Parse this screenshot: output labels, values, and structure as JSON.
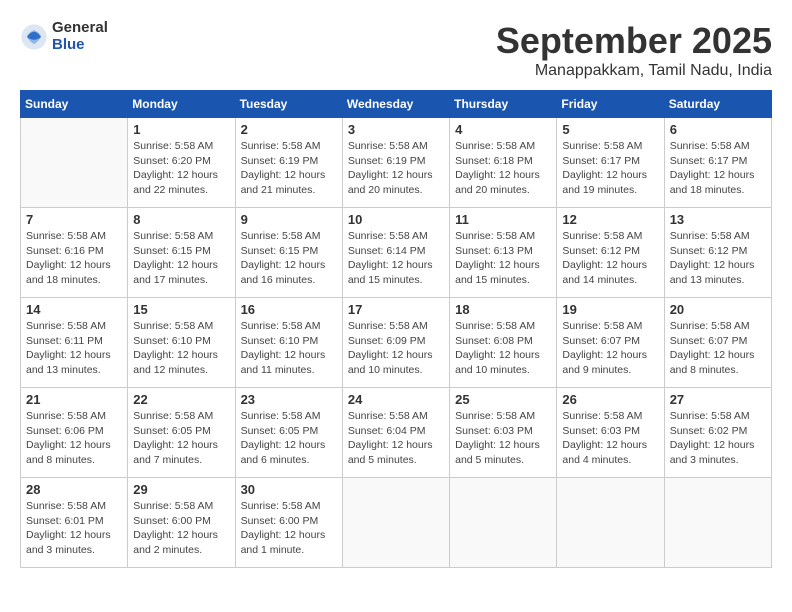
{
  "header": {
    "logo_general": "General",
    "logo_blue": "Blue",
    "month_title": "September 2025",
    "location": "Manappakkam, Tamil Nadu, India"
  },
  "weekdays": [
    "Sunday",
    "Monday",
    "Tuesday",
    "Wednesday",
    "Thursday",
    "Friday",
    "Saturday"
  ],
  "weeks": [
    [
      {
        "day": "",
        "info": ""
      },
      {
        "day": "1",
        "info": "Sunrise: 5:58 AM\nSunset: 6:20 PM\nDaylight: 12 hours\nand 22 minutes."
      },
      {
        "day": "2",
        "info": "Sunrise: 5:58 AM\nSunset: 6:19 PM\nDaylight: 12 hours\nand 21 minutes."
      },
      {
        "day": "3",
        "info": "Sunrise: 5:58 AM\nSunset: 6:19 PM\nDaylight: 12 hours\nand 20 minutes."
      },
      {
        "day": "4",
        "info": "Sunrise: 5:58 AM\nSunset: 6:18 PM\nDaylight: 12 hours\nand 20 minutes."
      },
      {
        "day": "5",
        "info": "Sunrise: 5:58 AM\nSunset: 6:17 PM\nDaylight: 12 hours\nand 19 minutes."
      },
      {
        "day": "6",
        "info": "Sunrise: 5:58 AM\nSunset: 6:17 PM\nDaylight: 12 hours\nand 18 minutes."
      }
    ],
    [
      {
        "day": "7",
        "info": "Sunrise: 5:58 AM\nSunset: 6:16 PM\nDaylight: 12 hours\nand 18 minutes."
      },
      {
        "day": "8",
        "info": "Sunrise: 5:58 AM\nSunset: 6:15 PM\nDaylight: 12 hours\nand 17 minutes."
      },
      {
        "day": "9",
        "info": "Sunrise: 5:58 AM\nSunset: 6:15 PM\nDaylight: 12 hours\nand 16 minutes."
      },
      {
        "day": "10",
        "info": "Sunrise: 5:58 AM\nSunset: 6:14 PM\nDaylight: 12 hours\nand 15 minutes."
      },
      {
        "day": "11",
        "info": "Sunrise: 5:58 AM\nSunset: 6:13 PM\nDaylight: 12 hours\nand 15 minutes."
      },
      {
        "day": "12",
        "info": "Sunrise: 5:58 AM\nSunset: 6:12 PM\nDaylight: 12 hours\nand 14 minutes."
      },
      {
        "day": "13",
        "info": "Sunrise: 5:58 AM\nSunset: 6:12 PM\nDaylight: 12 hours\nand 13 minutes."
      }
    ],
    [
      {
        "day": "14",
        "info": "Sunrise: 5:58 AM\nSunset: 6:11 PM\nDaylight: 12 hours\nand 13 minutes."
      },
      {
        "day": "15",
        "info": "Sunrise: 5:58 AM\nSunset: 6:10 PM\nDaylight: 12 hours\nand 12 minutes."
      },
      {
        "day": "16",
        "info": "Sunrise: 5:58 AM\nSunset: 6:10 PM\nDaylight: 12 hours\nand 11 minutes."
      },
      {
        "day": "17",
        "info": "Sunrise: 5:58 AM\nSunset: 6:09 PM\nDaylight: 12 hours\nand 10 minutes."
      },
      {
        "day": "18",
        "info": "Sunrise: 5:58 AM\nSunset: 6:08 PM\nDaylight: 12 hours\nand 10 minutes."
      },
      {
        "day": "19",
        "info": "Sunrise: 5:58 AM\nSunset: 6:07 PM\nDaylight: 12 hours\nand 9 minutes."
      },
      {
        "day": "20",
        "info": "Sunrise: 5:58 AM\nSunset: 6:07 PM\nDaylight: 12 hours\nand 8 minutes."
      }
    ],
    [
      {
        "day": "21",
        "info": "Sunrise: 5:58 AM\nSunset: 6:06 PM\nDaylight: 12 hours\nand 8 minutes."
      },
      {
        "day": "22",
        "info": "Sunrise: 5:58 AM\nSunset: 6:05 PM\nDaylight: 12 hours\nand 7 minutes."
      },
      {
        "day": "23",
        "info": "Sunrise: 5:58 AM\nSunset: 6:05 PM\nDaylight: 12 hours\nand 6 minutes."
      },
      {
        "day": "24",
        "info": "Sunrise: 5:58 AM\nSunset: 6:04 PM\nDaylight: 12 hours\nand 5 minutes."
      },
      {
        "day": "25",
        "info": "Sunrise: 5:58 AM\nSunset: 6:03 PM\nDaylight: 12 hours\nand 5 minutes."
      },
      {
        "day": "26",
        "info": "Sunrise: 5:58 AM\nSunset: 6:03 PM\nDaylight: 12 hours\nand 4 minutes."
      },
      {
        "day": "27",
        "info": "Sunrise: 5:58 AM\nSunset: 6:02 PM\nDaylight: 12 hours\nand 3 minutes."
      }
    ],
    [
      {
        "day": "28",
        "info": "Sunrise: 5:58 AM\nSunset: 6:01 PM\nDaylight: 12 hours\nand 3 minutes."
      },
      {
        "day": "29",
        "info": "Sunrise: 5:58 AM\nSunset: 6:00 PM\nDaylight: 12 hours\nand 2 minutes."
      },
      {
        "day": "30",
        "info": "Sunrise: 5:58 AM\nSunset: 6:00 PM\nDaylight: 12 hours\nand 1 minute."
      },
      {
        "day": "",
        "info": ""
      },
      {
        "day": "",
        "info": ""
      },
      {
        "day": "",
        "info": ""
      },
      {
        "day": "",
        "info": ""
      }
    ]
  ]
}
